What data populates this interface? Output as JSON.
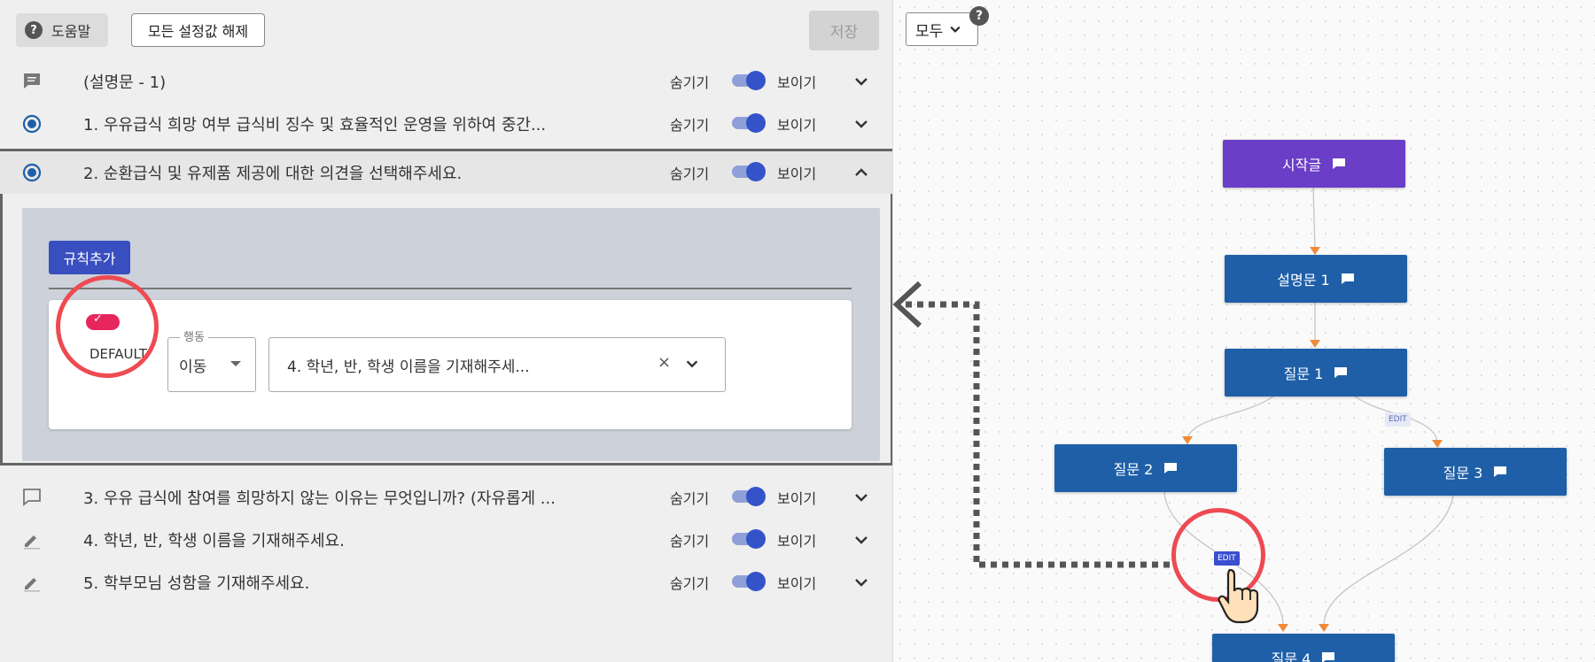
{
  "toolbar": {
    "help_label": "도움말",
    "reset_label": "모든 설정값 해제",
    "save_label": "저장"
  },
  "questions": [
    {
      "icon": "comment-icon",
      "text": "(설명문 - 1)",
      "hide": "숨기기",
      "show": "보이기",
      "visible": true
    },
    {
      "icon": "radio-icon",
      "text": "1. 우유급식 희망 여부 급식비 징수 및 효율적인 운영을 위하여 중간...",
      "hide": "숨기기",
      "show": "보이기",
      "visible": true
    },
    {
      "icon": "radio-icon",
      "text": "2. 순환급식 및 유제품 제공에 대한 의견을 선택해주세요.",
      "hide": "숨기기",
      "show": "보이기",
      "visible": true,
      "expanded": true
    },
    {
      "icon": "comment-outline-icon",
      "text": "3. 우유 급식에 참여를 희망하지 않는 이유는 무엇입니까? (자유롭게 ...",
      "hide": "숨기기",
      "show": "보이기",
      "visible": true
    },
    {
      "icon": "pencil-icon",
      "text": "4. 학년, 반, 학생 이름을 기재해주세요.",
      "hide": "숨기기",
      "show": "보이기",
      "visible": true
    },
    {
      "icon": "pencil-icon",
      "text": "5. 학부모님 성함을 기재해주세요.",
      "hide": "숨기기",
      "show": "보이기",
      "visible": true
    }
  ],
  "rule": {
    "add_label": "규칙추가",
    "default_label": "DEFAULT",
    "default_enabled": true,
    "action_legend": "행동",
    "action_value": "이동",
    "target_value": "4. 학년, 반, 학생 이름을 기재해주세...",
    "clear_symbol": "×"
  },
  "flow": {
    "mode_label": "모두",
    "help_symbol": "?",
    "nodes": {
      "start": "시작글",
      "desc1": "설명문 1",
      "q1": "질문 1",
      "q2": "질문 2",
      "q3": "질문 3",
      "q4": "질문 4"
    },
    "edit_label": "EDIT",
    "colors": {
      "node": "#1e5fa8",
      "start_node": "#6a3ec6",
      "highlight": "#ee4a52",
      "accent": "#3a4fbf"
    }
  }
}
